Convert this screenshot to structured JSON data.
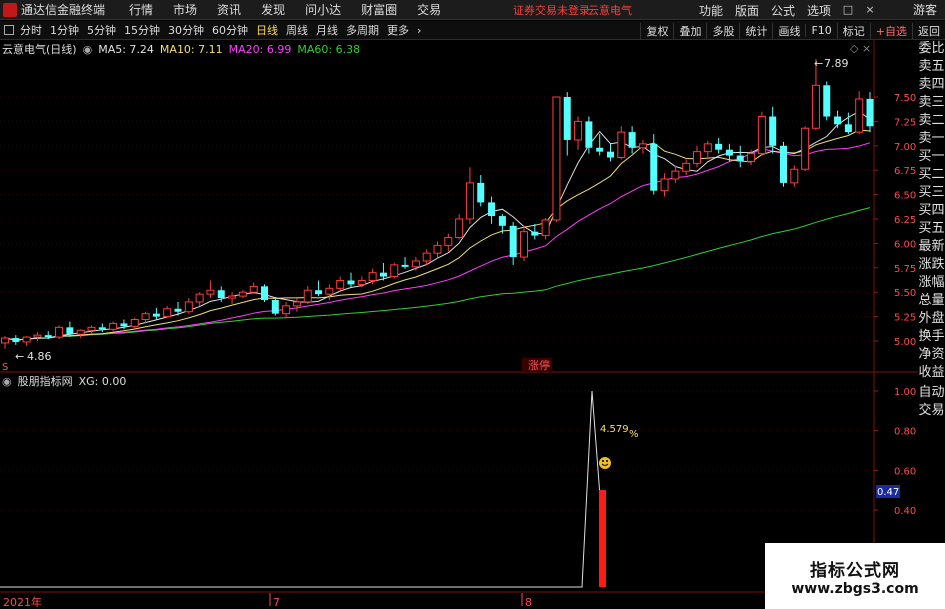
{
  "window": {
    "app_title": "通达信金融终端",
    "menu": [
      "行情",
      "市场",
      "资讯",
      "发现",
      "问小达",
      "财富圈",
      "交易"
    ],
    "login_status": "证券交易未登录",
    "stock_name": "云意电气",
    "right_menu": [
      "功能",
      "版面",
      "公式",
      "选项"
    ],
    "guest_label": "游客"
  },
  "toolbar": {
    "periods": [
      "分时",
      "1分钟",
      "5分钟",
      "15分钟",
      "30分钟",
      "60分钟",
      "日线",
      "周线",
      "月线",
      "多周期",
      "更多"
    ],
    "active_period": "日线",
    "right_buttons": [
      "复权",
      "叠加",
      "多股",
      "统计",
      "画线",
      "F10",
      "标记",
      "+自选",
      "返回"
    ]
  },
  "main_chart": {
    "title": "云意电气(日线)",
    "ma_labels": [
      "MA5: 7.24",
      "MA10: 7.11",
      "MA20: 6.99",
      "MA60: 6.38"
    ],
    "ma_colors": [
      "#e0e0e0",
      "#f0e070",
      "#ff3cff",
      "#30d030"
    ],
    "high_label": "7.89",
    "low_label": "4.86",
    "y_ticks": [
      "7.50",
      "7.25",
      "7.00",
      "6.75",
      "6.50",
      "6.25",
      "6.00",
      "5.75",
      "5.50",
      "5.25",
      "5.00"
    ],
    "event_tag": "涨停"
  },
  "indicator_chart": {
    "title": "股朋指标网",
    "value_label": "XG: 0.00",
    "peak_label": "4.579",
    "percent_sign": "%",
    "y_ticks": [
      "1.00",
      "0.80",
      "0.60",
      "0.40"
    ],
    "current_value": "0.47"
  },
  "x_axis": {
    "labels": [
      "2021年",
      "7",
      "8"
    ]
  },
  "side_panel": {
    "items": [
      "委比",
      "卖五",
      "卖四",
      "卖三",
      "卖二",
      "卖一",
      "买一",
      "买二",
      "买三",
      "买四",
      "买五",
      "最新",
      "涨跌",
      "涨幅",
      "总量",
      "外盘",
      "换手",
      "净资",
      "收益"
    ],
    "bottom": [
      "自动",
      "交易"
    ]
  },
  "watermark": {
    "text": "指标公式网",
    "url": "www.zbgs3.com"
  },
  "chart_data": {
    "type": "candlestick",
    "price_range": [
      4.86,
      7.89
    ],
    "candles": [
      [
        4.98,
        5.05,
        4.92,
        5.03
      ],
      [
        5.03,
        5.06,
        4.96,
        4.99
      ],
      [
        4.99,
        5.05,
        4.95,
        5.04
      ],
      [
        5.04,
        5.09,
        5.0,
        5.06
      ],
      [
        5.06,
        5.1,
        5.02,
        5.04
      ],
      [
        5.04,
        5.16,
        5.02,
        5.14
      ],
      [
        5.14,
        5.2,
        5.04,
        5.07
      ],
      [
        5.07,
        5.12,
        5.03,
        5.11
      ],
      [
        5.11,
        5.16,
        5.08,
        5.14
      ],
      [
        5.14,
        5.18,
        5.09,
        5.12
      ],
      [
        5.12,
        5.2,
        5.1,
        5.18
      ],
      [
        5.18,
        5.22,
        5.12,
        5.15
      ],
      [
        5.15,
        5.24,
        5.13,
        5.22
      ],
      [
        5.22,
        5.3,
        5.18,
        5.28
      ],
      [
        5.28,
        5.34,
        5.22,
        5.25
      ],
      [
        5.25,
        5.36,
        5.24,
        5.33
      ],
      [
        5.33,
        5.4,
        5.26,
        5.3
      ],
      [
        5.3,
        5.44,
        5.28,
        5.4
      ],
      [
        5.4,
        5.5,
        5.36,
        5.48
      ],
      [
        5.48,
        5.62,
        5.44,
        5.52
      ],
      [
        5.52,
        5.56,
        5.4,
        5.44
      ],
      [
        5.44,
        5.5,
        5.38,
        5.46
      ],
      [
        5.46,
        5.52,
        5.44,
        5.5
      ],
      [
        5.5,
        5.6,
        5.48,
        5.56
      ],
      [
        5.56,
        5.58,
        5.4,
        5.42
      ],
      [
        5.42,
        5.45,
        5.26,
        5.28
      ],
      [
        5.28,
        5.4,
        5.24,
        5.36
      ],
      [
        5.36,
        5.44,
        5.3,
        5.4
      ],
      [
        5.4,
        5.56,
        5.38,
        5.52
      ],
      [
        5.52,
        5.62,
        5.46,
        5.48
      ],
      [
        5.48,
        5.58,
        5.42,
        5.54
      ],
      [
        5.54,
        5.66,
        5.5,
        5.62
      ],
      [
        5.62,
        5.7,
        5.55,
        5.58
      ],
      [
        5.58,
        5.66,
        5.55,
        5.62
      ],
      [
        5.62,
        5.74,
        5.58,
        5.7
      ],
      [
        5.7,
        5.8,
        5.62,
        5.66
      ],
      [
        5.66,
        5.8,
        5.64,
        5.78
      ],
      [
        5.78,
        5.86,
        5.74,
        5.76
      ],
      [
        5.76,
        5.86,
        5.72,
        5.82
      ],
      [
        5.82,
        5.94,
        5.78,
        5.9
      ],
      [
        5.9,
        6.02,
        5.84,
        5.98
      ],
      [
        5.98,
        6.1,
        5.92,
        6.06
      ],
      [
        6.06,
        6.3,
        6.04,
        6.25
      ],
      [
        6.25,
        6.78,
        6.2,
        6.62
      ],
      [
        6.62,
        6.7,
        6.38,
        6.42
      ],
      [
        6.42,
        6.48,
        6.2,
        6.28
      ],
      [
        6.28,
        6.3,
        6.1,
        6.18
      ],
      [
        6.18,
        6.22,
        5.78,
        5.86
      ],
      [
        5.86,
        6.18,
        5.82,
        6.12
      ],
      [
        6.12,
        6.2,
        6.04,
        6.08
      ],
      [
        6.08,
        6.26,
        6.04,
        6.24
      ],
      [
        6.24,
        7.5,
        6.22,
        7.5
      ],
      [
        7.5,
        7.55,
        6.9,
        7.06
      ],
      [
        7.06,
        7.3,
        6.96,
        7.25
      ],
      [
        7.25,
        7.3,
        6.92,
        6.98
      ],
      [
        6.98,
        7.12,
        6.9,
        6.94
      ],
      [
        6.94,
        7.02,
        6.84,
        6.88
      ],
      [
        6.88,
        7.2,
        6.86,
        7.14
      ],
      [
        7.14,
        7.2,
        6.92,
        6.98
      ],
      [
        6.98,
        7.06,
        6.92,
        7.02
      ],
      [
        7.02,
        7.12,
        6.5,
        6.54
      ],
      [
        6.54,
        6.72,
        6.48,
        6.66
      ],
      [
        6.66,
        6.8,
        6.62,
        6.74
      ],
      [
        6.74,
        6.86,
        6.7,
        6.82
      ],
      [
        6.82,
        7.0,
        6.78,
        6.94
      ],
      [
        6.94,
        7.05,
        6.86,
        7.02
      ],
      [
        7.02,
        7.08,
        6.92,
        6.96
      ],
      [
        6.96,
        7.02,
        6.84,
        6.9
      ],
      [
        6.9,
        7.0,
        6.78,
        6.84
      ],
      [
        6.84,
        6.96,
        6.8,
        6.92
      ],
      [
        6.92,
        7.35,
        6.9,
        7.3
      ],
      [
        7.3,
        7.4,
        6.92,
        7.0
      ],
      [
        7.0,
        7.04,
        6.58,
        6.62
      ],
      [
        6.62,
        6.8,
        6.58,
        6.76
      ],
      [
        6.76,
        7.2,
        6.74,
        7.18
      ],
      [
        7.18,
        7.89,
        7.16,
        7.62
      ],
      [
        7.62,
        7.66,
        7.26,
        7.3
      ],
      [
        7.3,
        7.36,
        7.18,
        7.22
      ],
      [
        7.22,
        7.34,
        7.12,
        7.14
      ],
      [
        7.14,
        7.56,
        7.12,
        7.48
      ],
      [
        7.48,
        7.55,
        7.14,
        7.2
      ]
    ]
  }
}
